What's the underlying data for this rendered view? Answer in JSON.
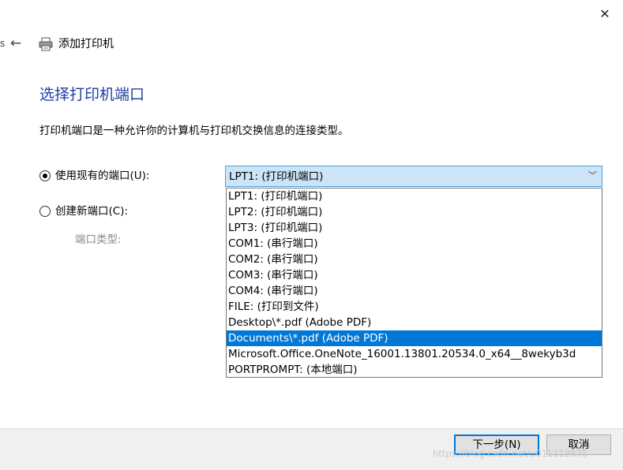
{
  "window": {
    "title": "添加打印机",
    "close_icon": "close-icon",
    "back_icon": "back-arrow-icon",
    "printer_icon": "printer-icon",
    "left_edge_glyph": "s"
  },
  "page": {
    "heading": "选择打印机端口",
    "description": "打印机端口是一种允许你的计算机与打印机交换信息的连接类型。"
  },
  "options": {
    "use_existing": {
      "label": "使用现有的端口(U):",
      "checked": true
    },
    "create_new": {
      "label": "创建新端口(C):",
      "checked": false
    },
    "port_type_label": "端口类型:"
  },
  "port_combo": {
    "selected_value": "LPT1: (打印机端口)",
    "expanded": true,
    "items": [
      "LPT1: (打印机端口)",
      "LPT2: (打印机端口)",
      "LPT3: (打印机端口)",
      "COM1: (串行端口)",
      "COM2: (串行端口)",
      "COM3: (串行端口)",
      "COM4: (串行端口)",
      "FILE: (打印到文件)",
      "Desktop\\*.pdf (Adobe PDF)",
      "Documents\\*.pdf (Adobe PDF)",
      "Microsoft.Office.OneNote_16001.13801.20534.0_x64__8wekyb3d",
      "PORTPROMPT: (本地端口)"
    ],
    "highlighted_index": 9
  },
  "footer": {
    "next_label": "下一步(N)",
    "cancel_label": "取消"
  },
  "watermark": "https://blog.csdn.net/u011119875",
  "colors": {
    "heading": "#1f3fa0",
    "combo_bg": "#cce4f7",
    "combo_border": "#4f9fd9",
    "highlight": "#0078d7",
    "footer_bg": "#f0f0f0"
  }
}
